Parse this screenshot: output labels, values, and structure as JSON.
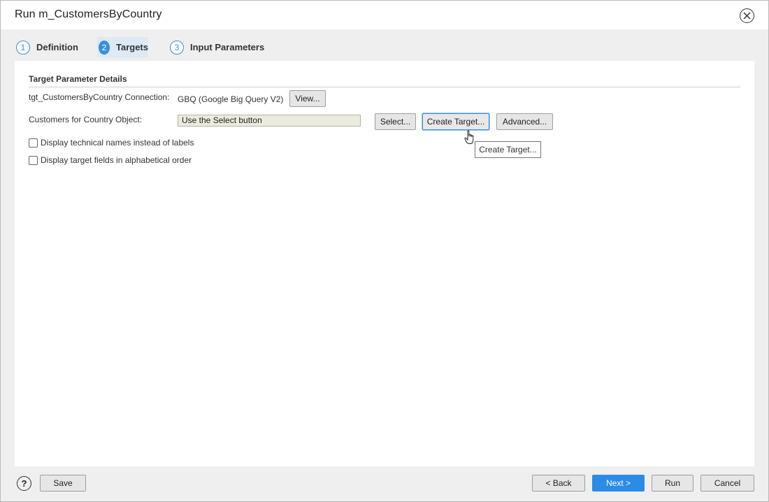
{
  "window": {
    "title": "Run m_CustomersByCountry",
    "close_icon": "close-circle-icon"
  },
  "steps": [
    {
      "number": "1",
      "label": "Definition",
      "active": false
    },
    {
      "number": "2",
      "label": "Targets",
      "active": true
    },
    {
      "number": "3",
      "label": "Input Parameters",
      "active": false
    }
  ],
  "target_details": {
    "section_title": "Target Parameter Details",
    "connection_label": "tgt_CustomersByCountry Connection:",
    "connection_value": "GBQ (Google Big Query V2)",
    "view_button": "View...",
    "object_label": "Customers for Country Object:",
    "object_value": "Use the Select button",
    "select_button": "Select...",
    "create_target_button": "Create Target...",
    "advanced_button": "Advanced...",
    "tooltip": "Create Target..."
  },
  "options": {
    "technical_names_label": "Display technical names instead of labels",
    "technical_names_checked": false,
    "alphabetical_label": "Display target fields in alphabetical order",
    "alphabetical_checked": false
  },
  "footer": {
    "help_glyph": "?",
    "save": "Save",
    "back": "< Back",
    "next": "Next >",
    "run": "Run",
    "cancel": "Cancel"
  },
  "colors": {
    "accent": "#2b8ce8",
    "object_field_bg": "#ecebdf"
  }
}
